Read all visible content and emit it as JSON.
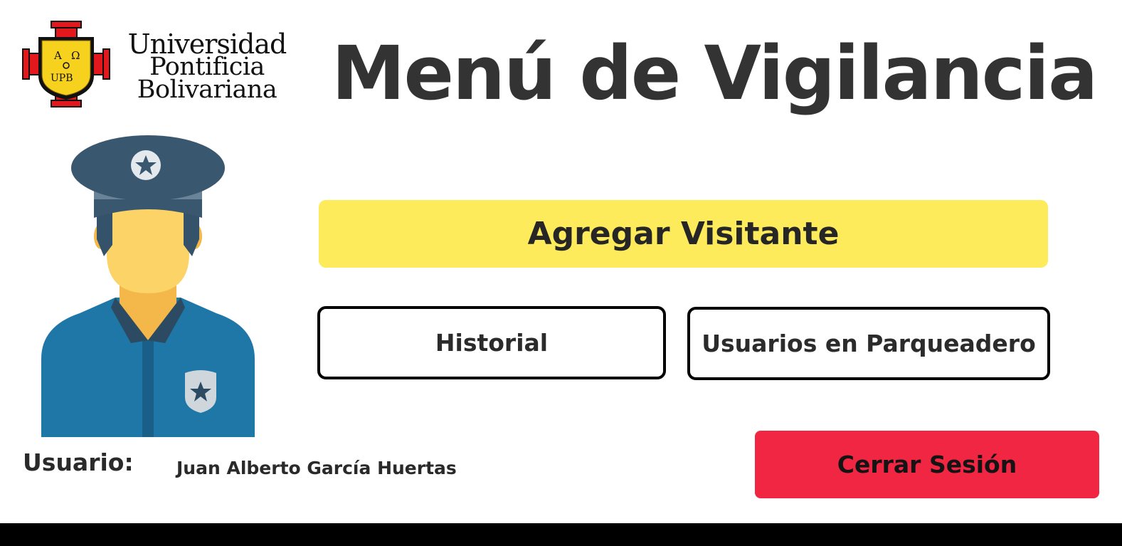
{
  "logo": {
    "name_lines": [
      "Universidad",
      "Pontificia",
      "Bolivariana"
    ],
    "seal_letters": [
      "A",
      "Ω",
      "UPB"
    ]
  },
  "header": {
    "title": "Menú de Vigilancia"
  },
  "guard": {
    "icon": "security-guard-avatar-icon"
  },
  "actions": {
    "add_visitor_label": "Agregar Visitante",
    "history_label": "Historial",
    "parking_users_label": "Usuarios en Parqueadero",
    "logout_label": "Cerrar Sesión"
  },
  "user": {
    "label": "Usuario:",
    "name": "Juan Alberto García Huertas"
  },
  "colors": {
    "add_visitor_bg": "#fdeb5c",
    "logout_bg": "#f12643",
    "title_text": "#333333",
    "bottom_bar": "#000000"
  }
}
